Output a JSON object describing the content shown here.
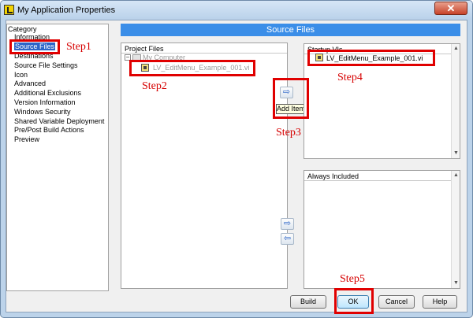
{
  "window": {
    "title": "My Application Properties",
    "close_glyph": "✕"
  },
  "category": {
    "header": "Category",
    "items": [
      {
        "label": "Information"
      },
      {
        "label": "Source Files"
      },
      {
        "label": "Destinations"
      },
      {
        "label": "Source File Settings"
      },
      {
        "label": "Icon"
      },
      {
        "label": "Advanced"
      },
      {
        "label": "Additional Exclusions"
      },
      {
        "label": "Version Information"
      },
      {
        "label": "Windows Security"
      },
      {
        "label": "Shared Variable Deployment"
      },
      {
        "label": "Pre/Post Build Actions"
      },
      {
        "label": "Preview"
      }
    ]
  },
  "banner": {
    "title": "Source Files"
  },
  "project_files": {
    "header": "Project Files",
    "toggle": "−",
    "root": "My Computer",
    "file": "LV_EditMenu_Example_001.vi"
  },
  "startup_vis": {
    "header": "Startup VIs",
    "file": "LV_EditMenu_Example_001.vi"
  },
  "always_included": {
    "header": "Always Included"
  },
  "arrows": {
    "add": "⇨",
    "remove": "⇦"
  },
  "tooltip": {
    "text": "Add Item"
  },
  "buttons": {
    "build": "Build",
    "ok": "OK",
    "cancel": "Cancel",
    "help": "Help"
  },
  "steps": {
    "step1": "Step1",
    "step2": "Step2",
    "step3": "Step3",
    "step4": "Step4",
    "step5": "Step5"
  },
  "colors": {
    "annotation_red": "#e00000",
    "banner_blue": "#3b8ee8",
    "selection_blue": "#2c64c8"
  }
}
